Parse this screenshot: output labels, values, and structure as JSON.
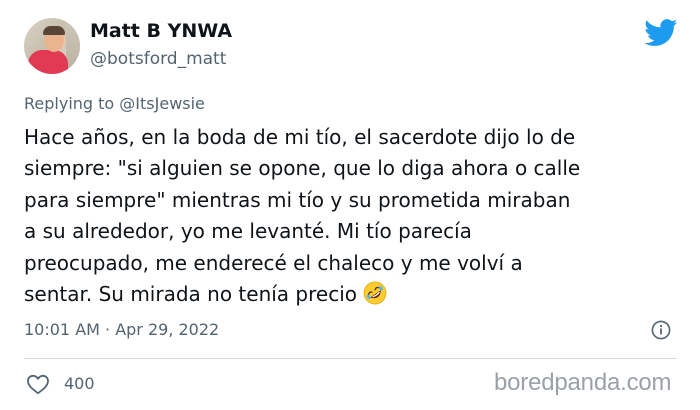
{
  "author": {
    "display_name": "Matt B YNWA",
    "handle": "@botsford_matt",
    "avatar": "avatar-photo"
  },
  "brand": {
    "logo": "twitter-bird-icon",
    "color": "#1d9bf0"
  },
  "reply": {
    "prefix": "Replying to ",
    "handle": "@ItsJewsie"
  },
  "tweet": {
    "lines": [
      "Hace años, en la boda de mi tío, el sacerdote dijo lo de",
      "siempre: \"si alguien se opone, que lo diga ahora o calle",
      "para siempre\" mientras mi tío y su prometida miraban",
      "a su alrededor, yo me levanté. Mi tío parecía",
      "preocupado, me enderecé el chaleco y me volví a",
      "sentar. Su mirada no tenía precio"
    ],
    "emoji": "rolling-on-floor-laughing-emoji"
  },
  "meta": {
    "timestamp": "10:01 AM · Apr 29, 2022",
    "info": "info-icon"
  },
  "engagement": {
    "likes": "400",
    "like_icon": "heart-icon"
  },
  "watermark": "boredpanda.com",
  "colors": {
    "text": "#0f1419",
    "secondary": "#536471",
    "divider": "#d4d9dd"
  }
}
